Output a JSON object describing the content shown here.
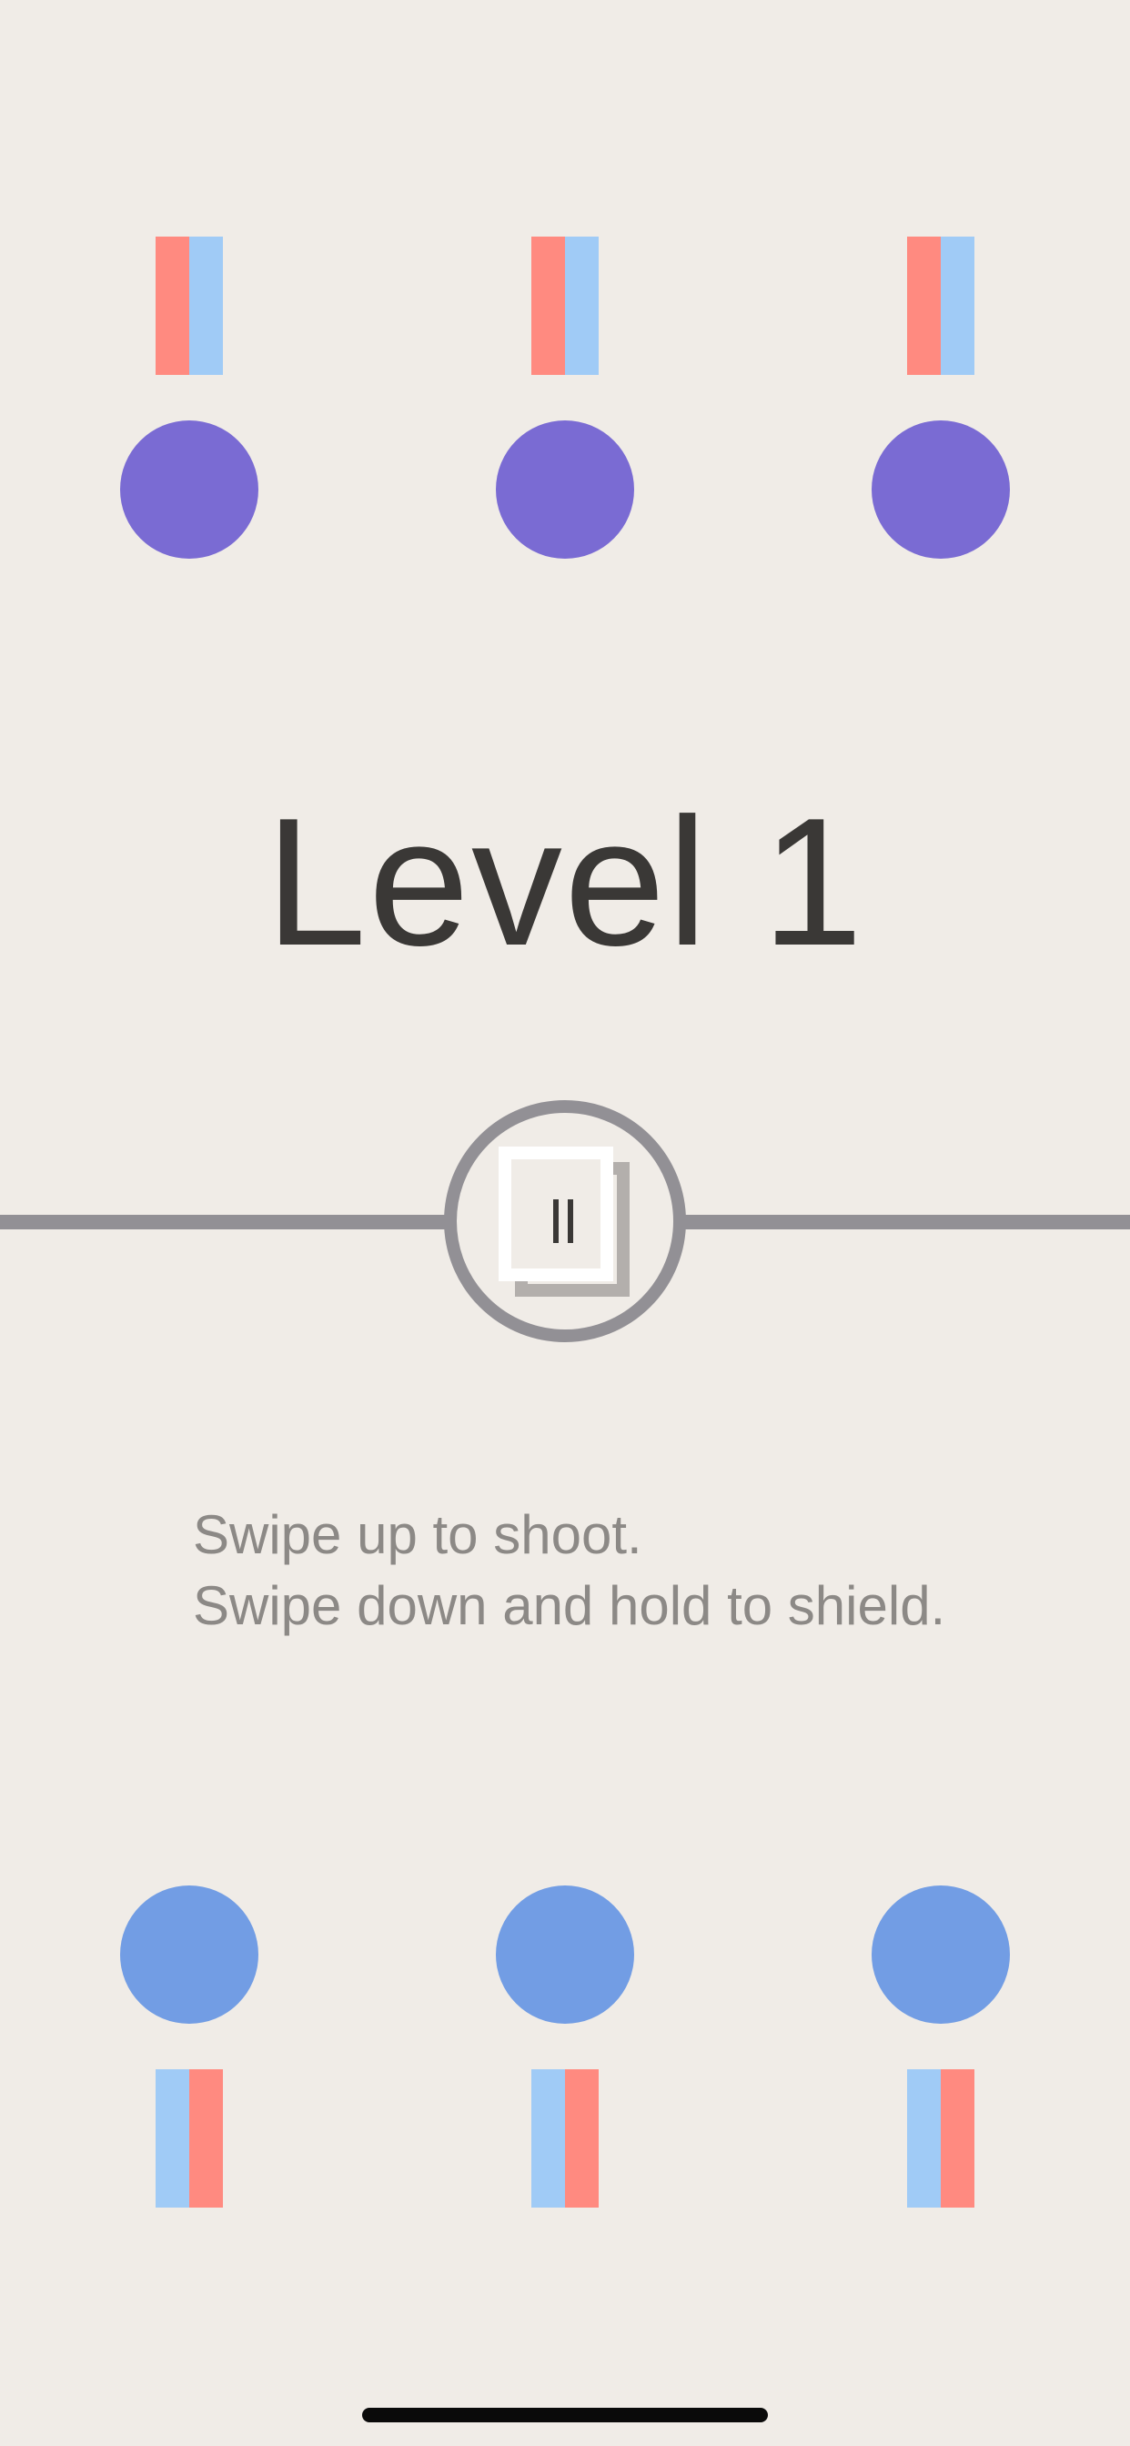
{
  "colors": {
    "background": "#f0ece7",
    "enemy_dot": "#7a6bd3",
    "player_dot": "#729de4",
    "bar_red": "#ff8a80",
    "bar_blue": "#a0cbf6",
    "divider": "#929095",
    "title_text": "#3a3836",
    "instruction_text": "#8c8986"
  },
  "enemies": [
    {
      "bar_left": "red",
      "bar_right": "blue"
    },
    {
      "bar_left": "red",
      "bar_right": "blue"
    },
    {
      "bar_left": "red",
      "bar_right": "blue"
    }
  ],
  "players": [
    {
      "bar_left": "blue",
      "bar_right": "red"
    },
    {
      "bar_left": "blue",
      "bar_right": "red"
    },
    {
      "bar_left": "blue",
      "bar_right": "red"
    }
  ],
  "level": {
    "title": "Level 1"
  },
  "pause": {
    "icon": "pause-icon"
  },
  "instructions": {
    "line1": "Swipe up to shoot.",
    "line2": "Swipe down and hold to shield."
  }
}
